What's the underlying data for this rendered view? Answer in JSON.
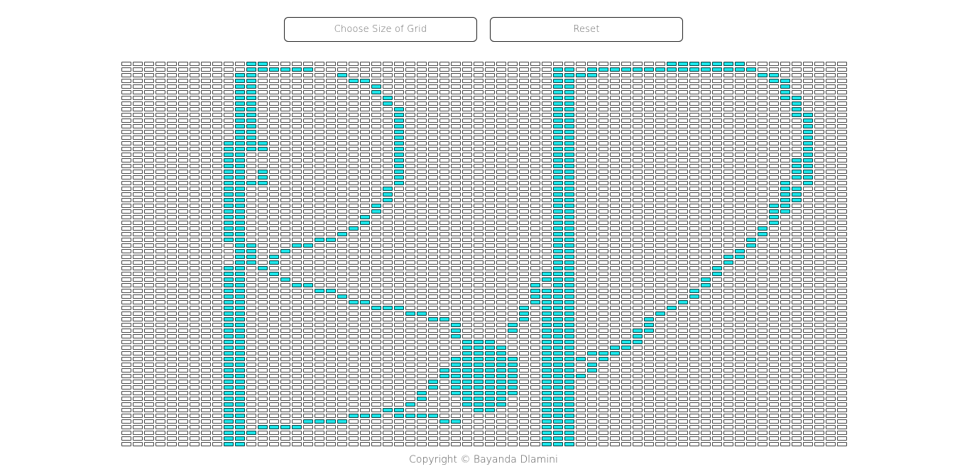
{
  "controls": {
    "choose_size_label": "Choose Size of Grid",
    "reset_label": "Reset"
  },
  "grid": {
    "columns": 64,
    "rows": 68,
    "empty_color": "#ffffff",
    "painted_color": "#1de6ea"
  },
  "footer": {
    "copyright": "Copyright © Bayanda Dlamini"
  }
}
